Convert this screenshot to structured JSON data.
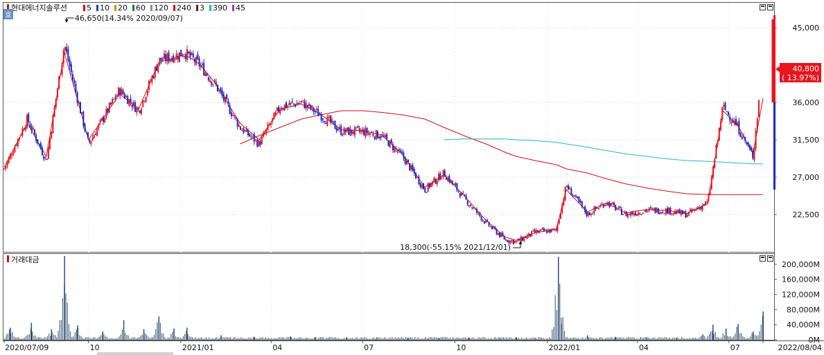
{
  "price_panel": {
    "stock_name": "현대에너지솔루션",
    "ma_legend": [
      {
        "label": "5",
        "color": "#d01010"
      },
      {
        "label": "10",
        "color": "#1a3fb8"
      },
      {
        "label": "20",
        "color": "#d68a00"
      },
      {
        "label": "60",
        "color": "#1e7a2e"
      },
      {
        "label": "120",
        "color": "#8c8c8c"
      },
      {
        "label": "240",
        "color": "#d01010"
      },
      {
        "label": "3",
        "color": "#6a1a1a"
      },
      {
        "label": "390",
        "color": "#22b7c8"
      },
      {
        "label": "45",
        "color": "#8a3fd0"
      }
    ],
    "side_tab": "호",
    "high_annotation": "46,650(14.34% 2020/09/07)",
    "low_annotation": "18,300(-55.15% 2021/12/01)",
    "current_price": "40,800",
    "current_change": "( 13.97%)",
    "colors": {
      "up": "#e8141e",
      "down": "#1a27c9",
      "price_box": "#e8141e"
    }
  },
  "volume_panel": {
    "title": "거래대금"
  },
  "x_axis_labels": [
    "2020/07/09",
    "10",
    "2021/01",
    "04",
    "07",
    "10",
    "2022/01",
    "04",
    "07",
    "2022/08/04"
  ],
  "chart_data": [
    {
      "type": "candlestick",
      "title": "현대에너지솔루션",
      "x_start": "2020/07/09",
      "x_end": "2022/08/04",
      "ylim": [
        18000,
        48000
      ],
      "y_ticks": [
        22500,
        27000,
        31500,
        36000,
        45000
      ],
      "y_tick_labels": [
        "22,500",
        "27,000",
        "31,500",
        "36,000",
        "45,000"
      ],
      "series": [
        {
          "name": "Close",
          "x": [
            "2020/07/09",
            "2020/08/01",
            "2020/08/20",
            "2020/09/07",
            "2020/10/01",
            "2020/11/01",
            "2020/11/20",
            "2020/12/10",
            "2021/01/05",
            "2021/01/20",
            "2021/02/05",
            "2021/03/01",
            "2021/03/20",
            "2021/04/10",
            "2021/05/01",
            "2021/05/20",
            "2021/06/10",
            "2021/07/01",
            "2021/07/20",
            "2021/08/10",
            "2021/09/01",
            "2021/09/20",
            "2021/10/10",
            "2021/11/01",
            "2021/11/20",
            "2021/12/01",
            "2021/12/20",
            "2022/01/10",
            "2022/01/20",
            "2022/02/10",
            "2022/03/01",
            "2022/03/20",
            "2022/04/10",
            "2022/05/01",
            "2022/05/20",
            "2022/06/10",
            "2022/06/25",
            "2022/07/10",
            "2022/07/25",
            "2022/08/04"
          ],
          "values": [
            28000,
            34000,
            29000,
            43000,
            31000,
            37500,
            35000,
            41000,
            42000,
            40500,
            38000,
            33000,
            31000,
            35500,
            36000,
            34500,
            32500,
            32500,
            32000,
            29500,
            25500,
            27500,
            24500,
            21500,
            19500,
            19200,
            20400,
            20600,
            26000,
            22500,
            24000,
            22500,
            23000,
            23000,
            22500,
            24000,
            35500,
            33000,
            29500,
            40800
          ]
        },
        {
          "name": "5",
          "values": [
            28200,
            33500,
            29500,
            42000,
            31500,
            37000,
            35200,
            40800,
            41800,
            40600,
            38200,
            33500,
            31500,
            35200,
            35800,
            34600,
            32700,
            32600,
            32100,
            29700,
            25800,
            27300,
            24800,
            21800,
            19800,
            19400,
            20300,
            20700,
            25500,
            22800,
            23900,
            22700,
            23100,
            23000,
            22600,
            23800,
            35000,
            33200,
            29800,
            36500
          ]
        },
        {
          "name": "240",
          "values": [
            null,
            null,
            null,
            null,
            null,
            null,
            null,
            null,
            null,
            null,
            null,
            31000,
            32000,
            33000,
            34000,
            34500,
            35000,
            35000,
            34800,
            34500,
            34000,
            33000,
            32000,
            31000,
            30000,
            29500,
            29000,
            28500,
            28000,
            27500,
            26800,
            26200,
            25700,
            25300,
            25000,
            24900,
            24900,
            24900,
            24900,
            24900
          ]
        },
        {
          "name": "390",
          "values": [
            null,
            null,
            null,
            null,
            null,
            null,
            null,
            null,
            null,
            null,
            null,
            null,
            null,
            null,
            null,
            null,
            null,
            null,
            null,
            null,
            null,
            31500,
            31600,
            31600,
            31600,
            31500,
            31400,
            31200,
            31000,
            30600,
            30200,
            29800,
            29500,
            29200,
            29000,
            28900,
            28800,
            28700,
            28600,
            28600
          ]
        }
      ]
    },
    {
      "type": "bar",
      "title": "거래대금",
      "x_start": "2020/07/09",
      "x_end": "2022/08/04",
      "ylim": [
        0,
        220000
      ],
      "y_ticks": [
        0,
        40000,
        80000,
        120000,
        160000,
        200000
      ],
      "y_tick_labels": [
        "0M",
        "40,000M",
        "80,000M",
        "120,000M",
        "160,000M",
        "200,000M"
      ],
      "series": [
        {
          "name": "거래대금",
          "x": [
            "2020/07/15",
            "2020/08/05",
            "2020/08/25",
            "2020/09/07",
            "2020/09/20",
            "2020/10/15",
            "2020/11/05",
            "2020/11/25",
            "2020/12/10",
            "2020/12/25",
            "2021/01/07",
            "2021/02/10",
            "2021/03/15",
            "2021/04/20",
            "2021/05/15",
            "2021/06/15",
            "2021/07/15",
            "2021/08/15",
            "2021/09/15",
            "2021/10/15",
            "2021/11/15",
            "2021/12/01",
            "2021/12/20",
            "2022/01/12",
            "2022/01/15",
            "2022/02/10",
            "2022/03/10",
            "2022/04/10",
            "2022/05/10",
            "2022/06/05",
            "2022/06/15",
            "2022/06/28",
            "2022/07/10",
            "2022/07/25",
            "2022/08/04"
          ],
          "values": [
            32000,
            45000,
            28000,
            222000,
            38000,
            22000,
            52000,
            28000,
            62000,
            30000,
            32000,
            12000,
            8000,
            9000,
            7000,
            6000,
            6000,
            5000,
            5000,
            6000,
            5000,
            7000,
            5000,
            220000,
            42000,
            12000,
            8000,
            7000,
            6000,
            14000,
            40000,
            30000,
            42000,
            22000,
            75000
          ]
        }
      ]
    }
  ]
}
